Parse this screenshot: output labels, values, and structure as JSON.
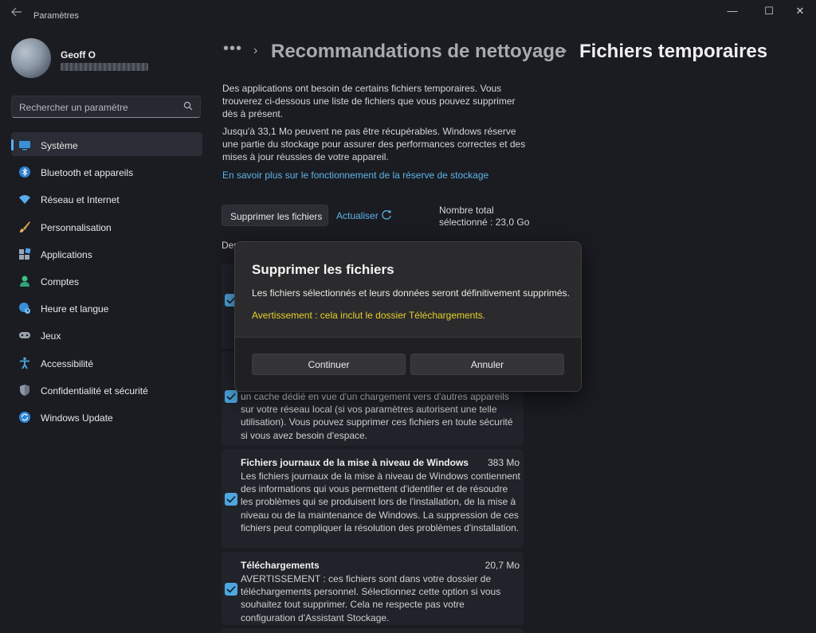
{
  "window": {
    "title": "Paramètres",
    "back_icon": "arrow-left-icon",
    "minimize_glyph": "—",
    "maximize_glyph": "☐",
    "close_glyph": "✕"
  },
  "account": {
    "name": "Geoff O"
  },
  "search": {
    "placeholder": "Rechercher un paramètre"
  },
  "sidebar": {
    "items": [
      {
        "label": "Système",
        "icon": "monitor-icon",
        "active": true
      },
      {
        "label": "Bluetooth et appareils",
        "icon": "bluetooth-icon"
      },
      {
        "label": "Réseau et Internet",
        "icon": "wifi-icon"
      },
      {
        "label": "Personnalisation",
        "icon": "brush-icon"
      },
      {
        "label": "Applications",
        "icon": "apps-icon"
      },
      {
        "label": "Comptes",
        "icon": "person-icon"
      },
      {
        "label": "Heure et langue",
        "icon": "globe-clock-icon"
      },
      {
        "label": "Jeux",
        "icon": "gamepad-icon"
      },
      {
        "label": "Accessibilité",
        "icon": "accessibility-icon"
      },
      {
        "label": "Confidentialité et sécurité",
        "icon": "shield-icon"
      },
      {
        "label": "Windows Update",
        "icon": "update-icon"
      }
    ]
  },
  "breadcrumb": {
    "more": "•••",
    "separator": "›",
    "parent": "Recommandations de nettoyage",
    "current": "Fichiers temporaires"
  },
  "main": {
    "intro_1": "Des applications ont besoin de certains fichiers temporaires. Vous trouverez ci-dessous une liste de fichiers que vous pouvez supprimer dès à présent.",
    "intro_2": "Jusqu'à 33,1 Mo peuvent ne pas être récupérables. Windows réserve une partie du stockage pour assurer des performances correctes et des mises à jour réussies de votre appareil.",
    "learn_more": "En savoir plus sur le fonctionnement de la réserve de stockage",
    "delete_button": "Supprimer les fichiers",
    "refresh_label": "Actualiser",
    "total_line1": "Nombre total",
    "total_line2": "sélectionné : 23,0 Go",
    "section_heading": "Der"
  },
  "cards": [
    {
      "title": "",
      "size": "",
      "desc": "",
      "checked": true
    },
    {
      "title": "",
      "size": "",
      "desc": "un cache dédié en vue d'un chargement vers d'autres appareils sur votre réseau local (si vos paramètres autorisent une telle utilisation). Vous pouvez supprimer ces fichiers en toute sécurité si vous avez besoin d'espace.",
      "checked": true
    },
    {
      "title": "Fichiers journaux de la mise à niveau de Windows",
      "size": "383 Mo",
      "desc": "Les fichiers journaux de la mise à niveau de Windows contiennent des informations qui vous permettent d'identifier et de résoudre les problèmes qui se produisent lors de l'installation, de la mise à niveau ou de la maintenance de Windows. La suppression de ces fichiers peut compliquer la résolution des problèmes d'installation.",
      "checked": true
    },
    {
      "title": "Téléchargements",
      "size": "20,7 Mo",
      "desc": "AVERTISSEMENT : ces fichiers sont dans votre dossier de téléchargements personnel. Sélectionnez cette option si vous souhaitez tout supprimer. Cela ne respecte pas votre configuration d'Assistant Stockage.",
      "checked": true
    }
  ],
  "dialog": {
    "title": "Supprimer les fichiers",
    "message": "Les fichiers sélectionnés et leurs données seront définitivement supprimés.",
    "warning": "Avertissement : cela inclut le dossier Téléchargements.",
    "continue_label": "Continuer",
    "cancel_label": "Annuler",
    "warning_color": "#e7cf2e"
  },
  "colors": {
    "accent": "#4ea7e0",
    "link": "#5fb3e6",
    "background": "#1a1c22"
  }
}
